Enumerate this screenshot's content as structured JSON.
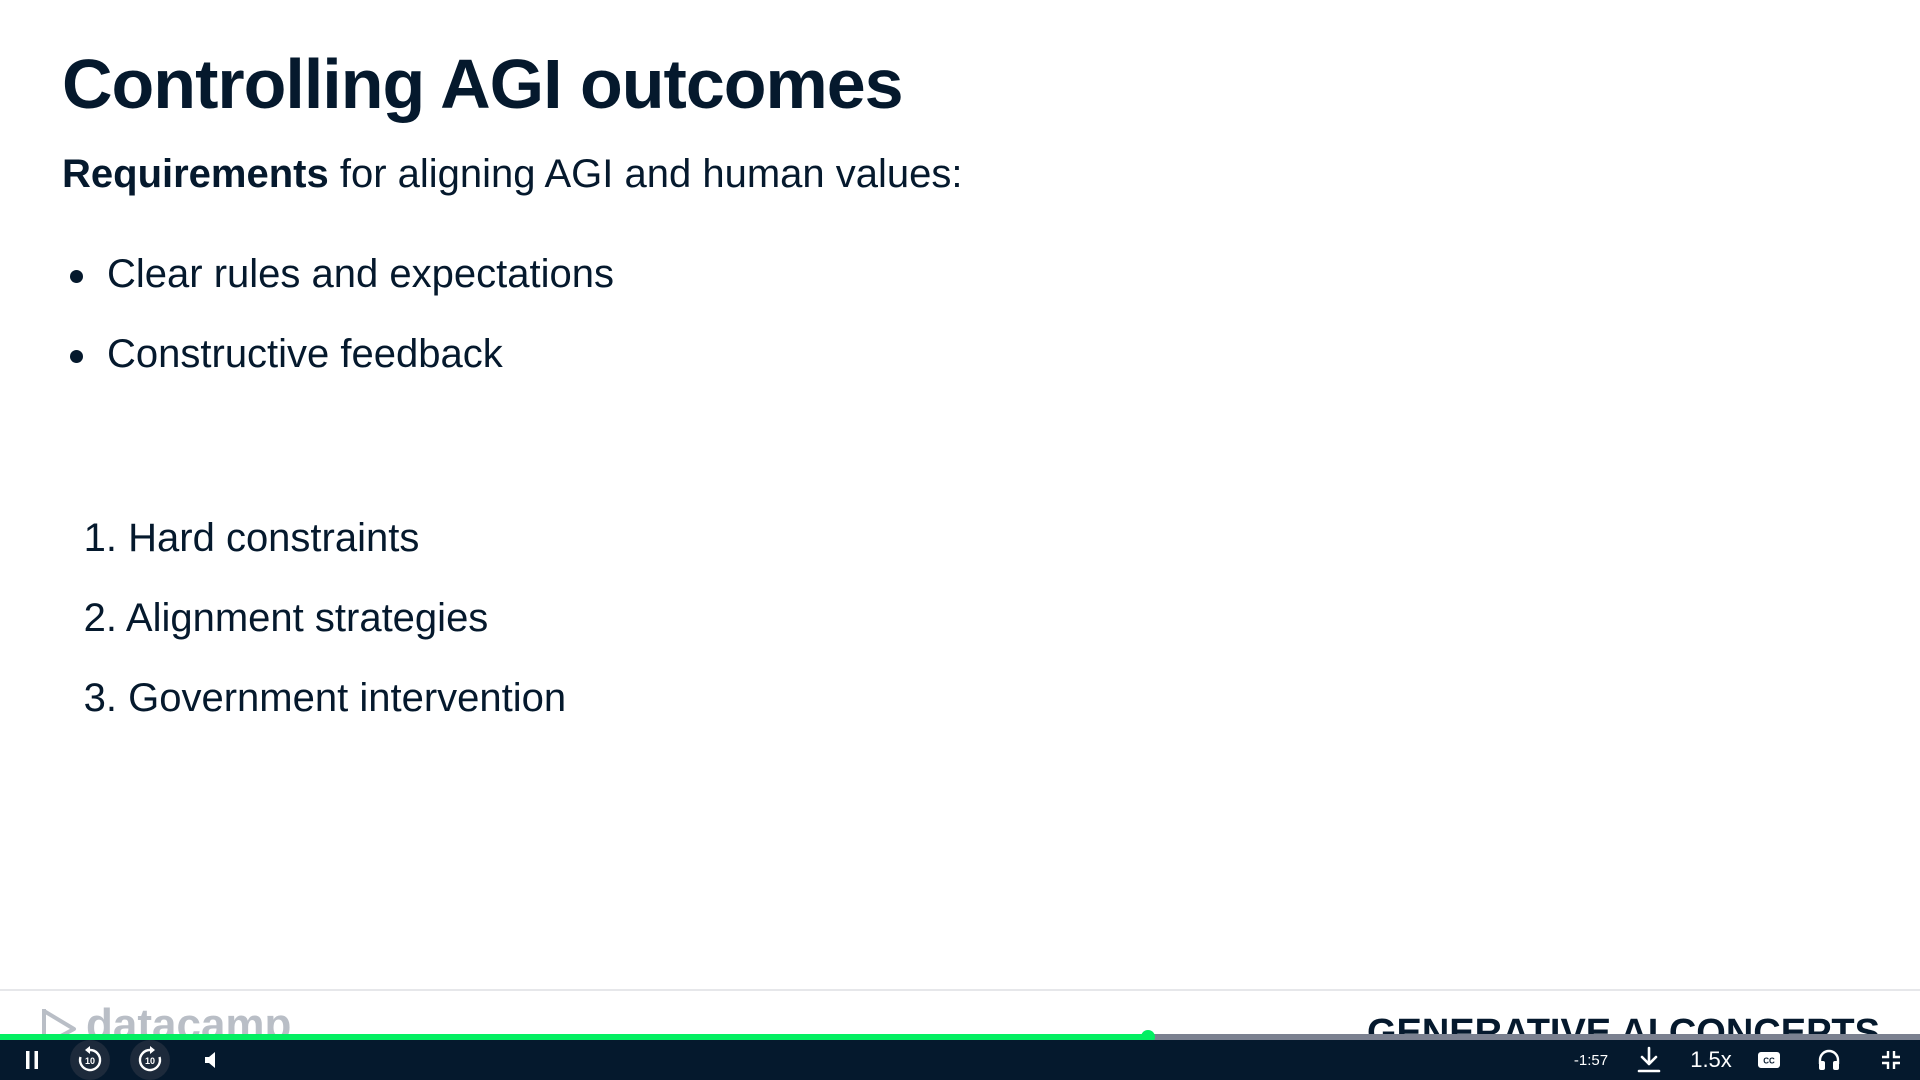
{
  "slide": {
    "title": "Controlling AGI outcomes",
    "intro_bold": "Requirements",
    "intro_rest": " for aligning AGI and human values:",
    "bullets": [
      "Clear rules and expectations",
      "Constructive feedback"
    ],
    "numbered": [
      {
        "num": "1.",
        "text": "Hard constraints"
      },
      {
        "num": "2.",
        "text": "Alignment strategies"
      },
      {
        "num": "3.",
        "text": "Government intervention"
      }
    ]
  },
  "footer": {
    "logo_text": "datacamp",
    "course_name": "GENERATIVE AI CONCEPTS"
  },
  "player": {
    "progress": 0.598,
    "time_remaining": "-1:57",
    "speed": "1.5x",
    "icons": {
      "pause": "pause-icon",
      "rewind": "rewind-10-icon",
      "forward": "forward-10-icon",
      "volume": "volume-icon",
      "download": "download-icon",
      "captions": "captions-icon",
      "audio": "headphones-icon",
      "fullscreen": "exit-fullscreen-icon"
    },
    "colors": {
      "bar_background": "#05192d",
      "progress_fill": "#03ef62",
      "progress_track": "#7b8190"
    }
  }
}
